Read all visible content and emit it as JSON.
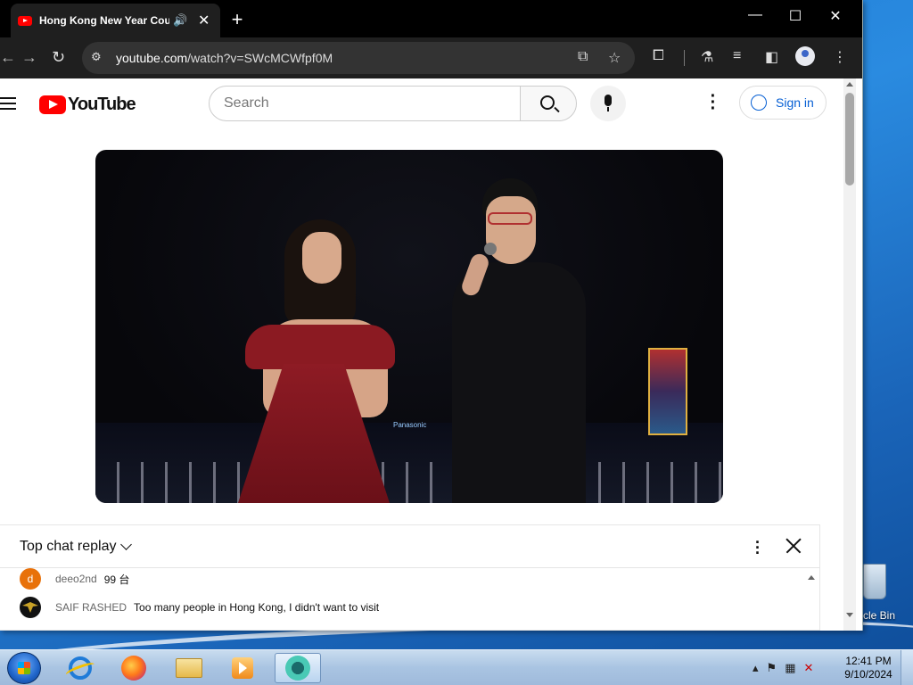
{
  "desktop": {
    "recycle_bin_label": "rcle Bin"
  },
  "browser": {
    "tab": {
      "title": "Hong Kong New Year Coun",
      "audio_icon": "speaker-icon",
      "close_glyph": "✕"
    },
    "new_tab_glyph": "+",
    "window_controls": {
      "minimize": "—",
      "maximize": "☐",
      "close": "✕"
    },
    "url_host": "youtube.com",
    "url_path": "/watch?v=SWcMCWfpf0M"
  },
  "youtube": {
    "logo_text": "YouTube",
    "search_placeholder": "Search",
    "sign_in_label": "Sign in"
  },
  "chat": {
    "title": "Top chat replay",
    "messages": [
      {
        "avatar_letter": "d",
        "avatar_color": "#e8710a",
        "author": "deeo2nd",
        "text": "99 台"
      },
      {
        "avatar_letter": "",
        "avatar_color": "#111111",
        "author": "SAIF RASHED",
        "text": "Too many people in Hong Kong, I didn't want to visit"
      }
    ]
  },
  "video": {
    "sign_text": "Panasonic"
  },
  "taskbar": {
    "time": "12:41 PM",
    "date": "9/10/2024"
  }
}
